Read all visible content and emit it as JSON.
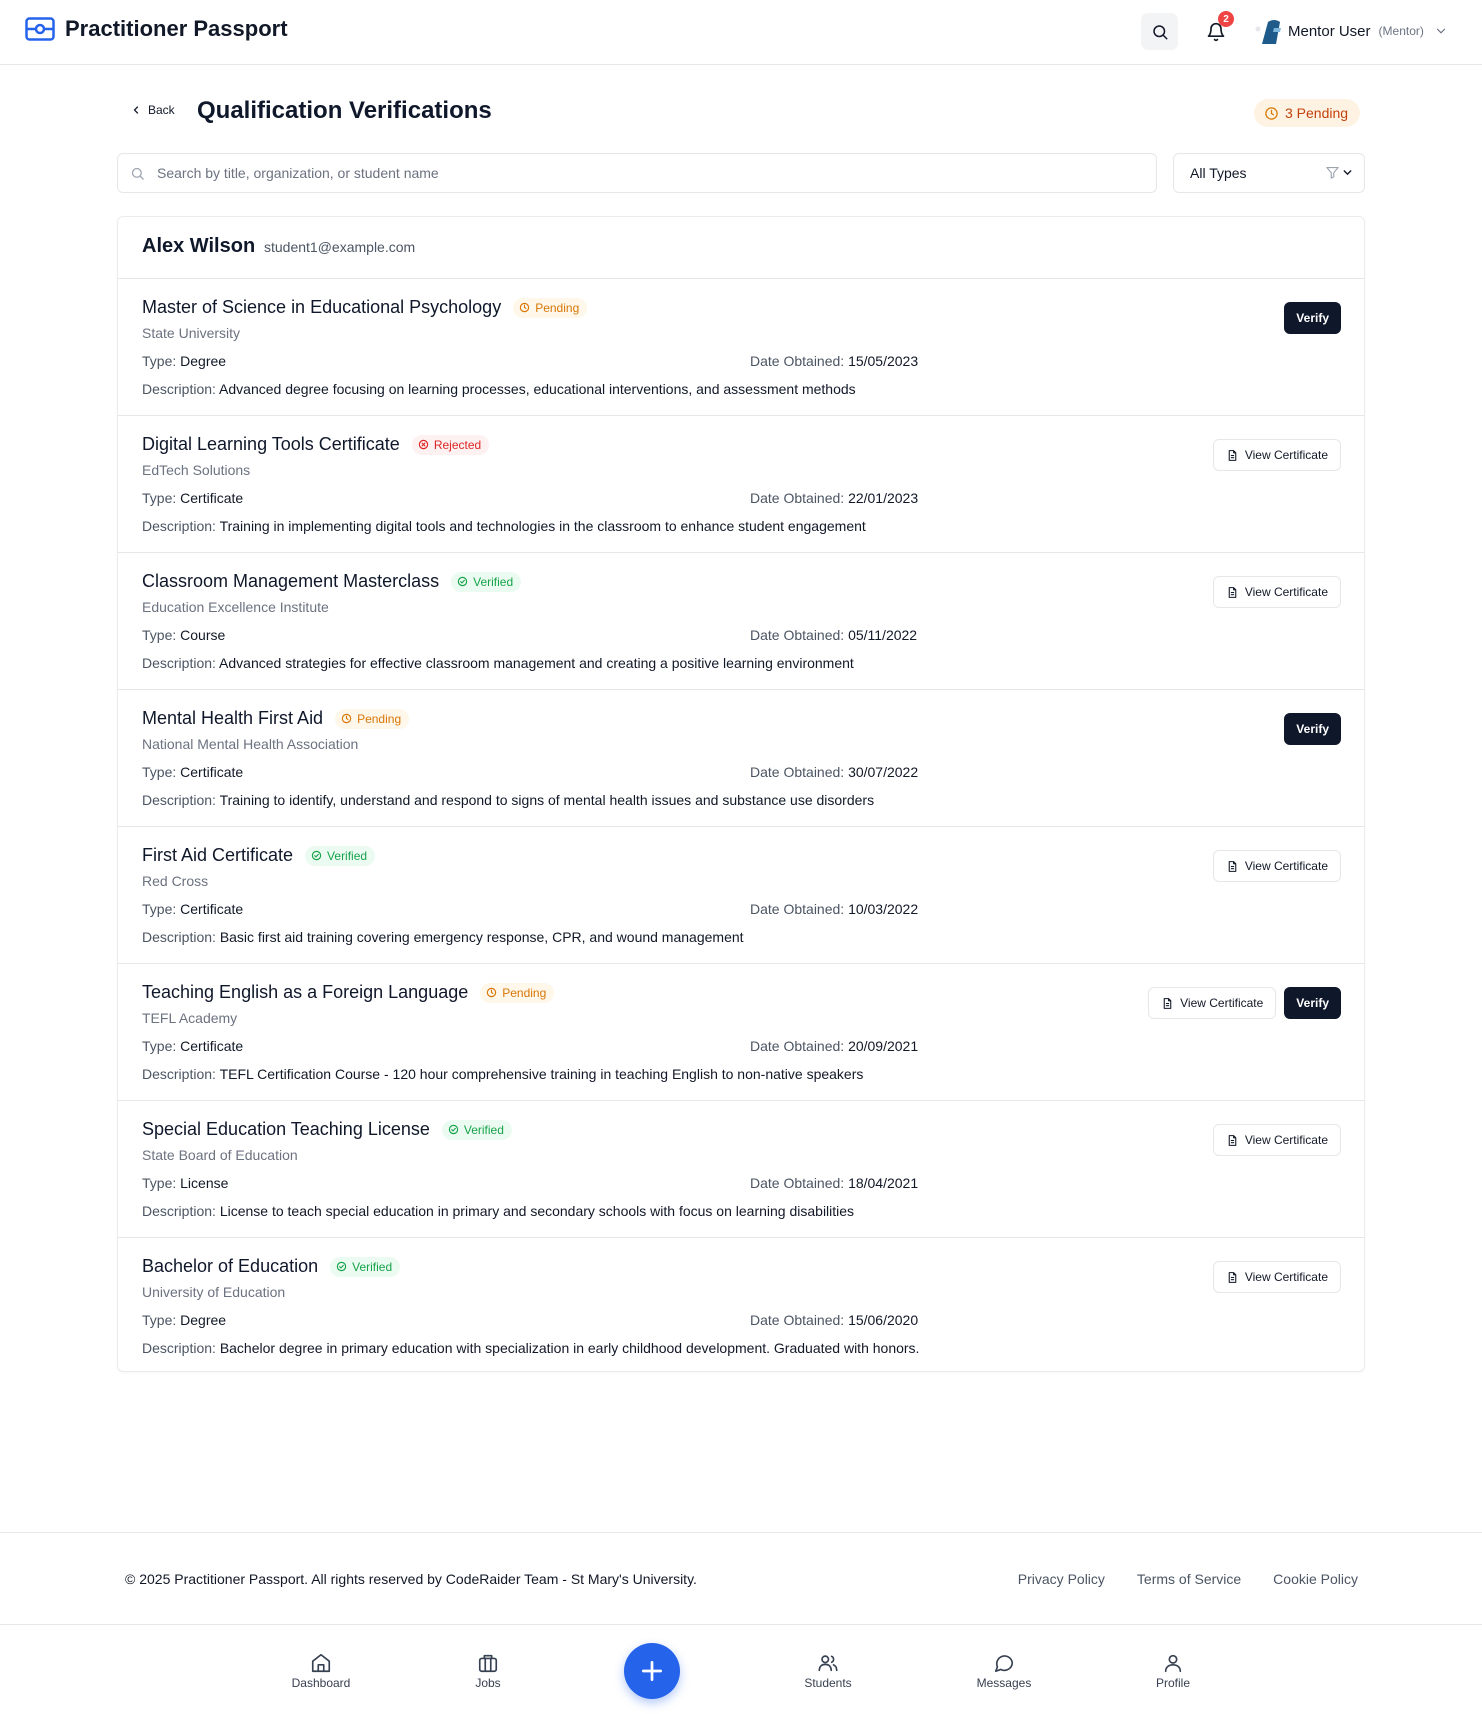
{
  "header": {
    "brand": "Practitioner Passport",
    "notification_count": "2",
    "user_name": "Mentor User",
    "user_role": "(Mentor)"
  },
  "page": {
    "back_label": "Back",
    "title": "Qualification Verifications",
    "pending_label": "3 Pending"
  },
  "filters": {
    "search_placeholder": "Search by title, organization, or student name",
    "type_selected": "All Types"
  },
  "student": {
    "name": "Alex Wilson",
    "email": "student1@example.com"
  },
  "labels": {
    "type": "Type:",
    "date": "Date Obtained:",
    "description": "Description:",
    "verify": "Verify",
    "view_certificate": "View Certificate"
  },
  "qualifications": [
    {
      "title": "Master of Science in Educational Psychology",
      "status": "Pending",
      "organization": "State University",
      "type": "Degree",
      "date": "15/05/2023",
      "description": "Advanced degree focusing on learning processes, educational interventions, and assessment methods"
    },
    {
      "title": "Digital Learning Tools Certificate",
      "status": "Rejected",
      "organization": "EdTech Solutions",
      "type": "Certificate",
      "date": "22/01/2023",
      "description": "Training in implementing digital tools and technologies in the classroom to enhance student engagement"
    },
    {
      "title": "Classroom Management Masterclass",
      "status": "Verified",
      "organization": "Education Excellence Institute",
      "type": "Course",
      "date": "05/11/2022",
      "description": "Advanced strategies for effective classroom management and creating a positive learning environment"
    },
    {
      "title": "Mental Health First Aid",
      "status": "Pending",
      "organization": "National Mental Health Association",
      "type": "Certificate",
      "date": "30/07/2022",
      "description": "Training to identify, understand and respond to signs of mental health issues and substance use disorders"
    },
    {
      "title": "First Aid Certificate",
      "status": "Verified",
      "organization": "Red Cross",
      "type": "Certificate",
      "date": "10/03/2022",
      "description": "Basic first aid training covering emergency response, CPR, and wound management"
    },
    {
      "title": "Teaching English as a Foreign Language",
      "status": "Pending",
      "organization": "TEFL Academy",
      "type": "Certificate",
      "date": "20/09/2021",
      "description": "TEFL Certification Course - 120 hour comprehensive training in teaching English to non-native speakers"
    },
    {
      "title": "Special Education Teaching License",
      "status": "Verified",
      "organization": "State Board of Education",
      "type": "License",
      "date": "18/04/2021",
      "description": "License to teach special education in primary and secondary schools with focus on learning disabilities"
    },
    {
      "title": "Bachelor of Education",
      "status": "Verified",
      "organization": "University of Education",
      "type": "Degree",
      "date": "15/06/2020",
      "description": "Bachelor degree in primary education with specialization in early childhood development. Graduated with honors."
    }
  ],
  "footer": {
    "copyright": "© 2025 Practitioner Passport. All rights reserved by CodeRaider Team - St Mary's University.",
    "links": [
      "Privacy Policy",
      "Terms of Service",
      "Cookie Policy"
    ]
  },
  "bottom_nav": {
    "items": [
      "Dashboard",
      "Jobs",
      "Students",
      "Messages",
      "Profile"
    ]
  },
  "colors": {
    "primary_dark": "#0f172a",
    "accent_blue": "#2563eb",
    "pending": "#d97706",
    "rejected": "#dc2626",
    "verified": "#16a34a"
  }
}
